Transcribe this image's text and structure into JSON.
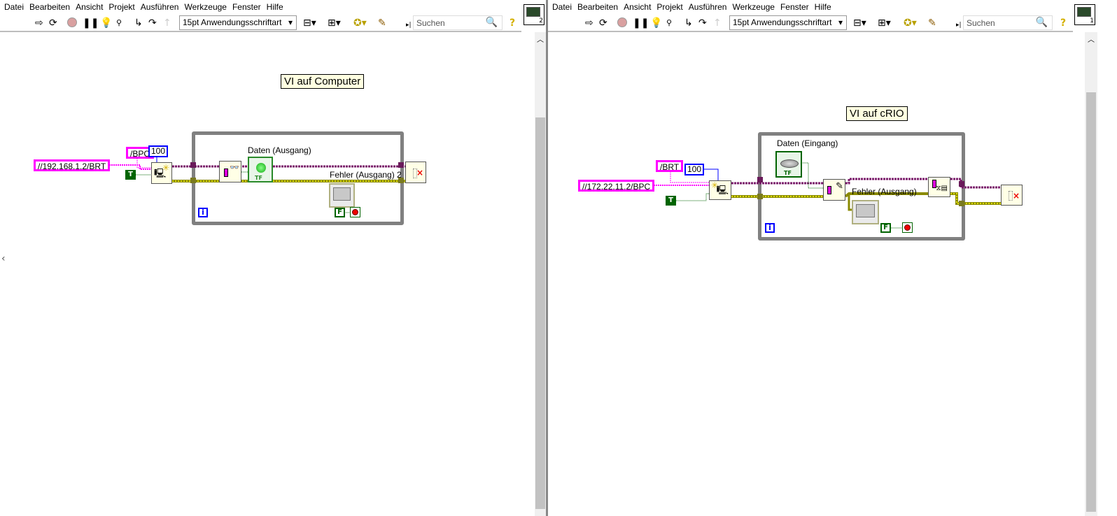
{
  "menu": [
    "Datei",
    "Bearbeiten",
    "Ansicht",
    "Projekt",
    "Ausführen",
    "Werkzeuge",
    "Fenster",
    "Hilfe"
  ],
  "toolbar": {
    "font": "15pt Anwendungsschriftart",
    "search_placeholder": "Suchen",
    "help": "?"
  },
  "left": {
    "title_label": "VI auf Computer",
    "vi_icon_number": "2",
    "url_constant": "//192.168.1.2/BRT",
    "name_constant": "/BPC",
    "timeout_constant": "100",
    "true_constant": "T",
    "false_constant": "F",
    "iteration": "i",
    "data_label": "Daten (Ausgang)",
    "error_label": "Fehler (Ausgang) 2",
    "indicator_text": "TF"
  },
  "right": {
    "title_label": "VI auf cRIO",
    "vi_icon_number": "1",
    "url_constant": "//172.22.11.2/BPC",
    "name_constant": "/BRT",
    "timeout_constant": "100",
    "true_constant": "T",
    "false_constant": "F",
    "iteration": "i",
    "data_label": "Daten (Eingang)",
    "error_label": "Fehler (Ausgang)",
    "control_text": "TF"
  },
  "colors": {
    "string_wire": "#ff00ff",
    "refnum_wire": "#7a1a6a",
    "error_wire": "#c8c800",
    "loop": "#808080"
  }
}
